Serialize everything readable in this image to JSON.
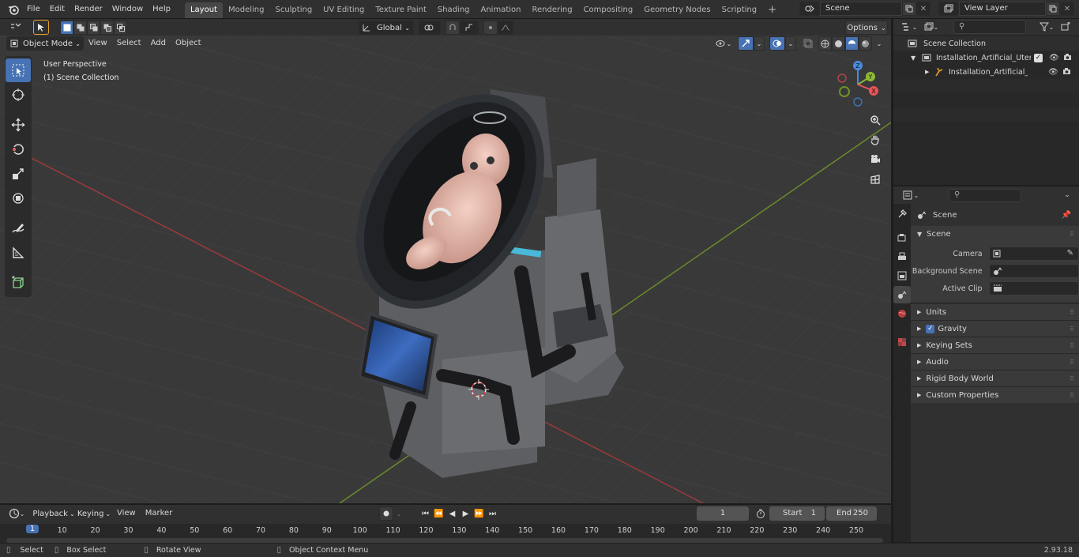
{
  "topbar": {
    "menu": [
      "File",
      "Edit",
      "Render",
      "Window",
      "Help"
    ],
    "workspaces": [
      "Layout",
      "Modeling",
      "Sculpting",
      "UV Editing",
      "Texture Paint",
      "Shading",
      "Animation",
      "Rendering",
      "Compositing",
      "Geometry Nodes",
      "Scripting"
    ],
    "active_workspace": "Layout",
    "add_tab": "+",
    "scene_name": "Scene",
    "view_layer": "View Layer"
  },
  "tool_header": {
    "transform_orientation": "Global",
    "options": "Options"
  },
  "viewport_header": {
    "mode": "Object Mode",
    "menus": [
      "View",
      "Select",
      "Add",
      "Object"
    ]
  },
  "viewport": {
    "perspective": "User Perspective",
    "collection": "(1) Scene Collection",
    "gizmo_axes": {
      "x": "X",
      "y": "Y",
      "z": "Z"
    },
    "accent_x": "#e8545a",
    "accent_y": "#8cba36",
    "accent_z": "#4a8be0"
  },
  "toolbar_tools": [
    "select-box",
    "cursor",
    "move",
    "rotate",
    "scale",
    "transform",
    "annotate",
    "measure",
    "add-cube"
  ],
  "outliner": {
    "root": "Scene Collection",
    "items": [
      {
        "label": "Installation_Artificial_Uterus_C",
        "level": 1
      },
      {
        "label": "Installation_Artificial_Uter",
        "level": 2
      }
    ]
  },
  "properties": {
    "context": "Scene",
    "section": "Scene",
    "fields": [
      {
        "label": "Camera",
        "value": ""
      },
      {
        "label": "Background Scene",
        "value": ""
      },
      {
        "label": "Active Clip",
        "value": ""
      }
    ],
    "subpanels": [
      "Units",
      "Gravity",
      "Keying Sets",
      "Audio",
      "Rigid Body World",
      "Custom Properties"
    ]
  },
  "timeline": {
    "menus": [
      "Playback",
      "Keying",
      "View",
      "Marker"
    ],
    "current_frame": "1",
    "start_label": "Start",
    "start": "1",
    "end_label": "End",
    "end": "250",
    "ticks": [
      "1",
      "10",
      "20",
      "30",
      "40",
      "50",
      "60",
      "70",
      "80",
      "90",
      "100",
      "110",
      "120",
      "130",
      "140",
      "150",
      "160",
      "170",
      "180",
      "190",
      "200",
      "210",
      "220",
      "230",
      "240",
      "250"
    ]
  },
  "statusbar": {
    "select": "Select",
    "box_select": "Box Select",
    "rotate_view": "Rotate View",
    "context_menu": "Object Context Menu",
    "version": "2.93.18"
  }
}
